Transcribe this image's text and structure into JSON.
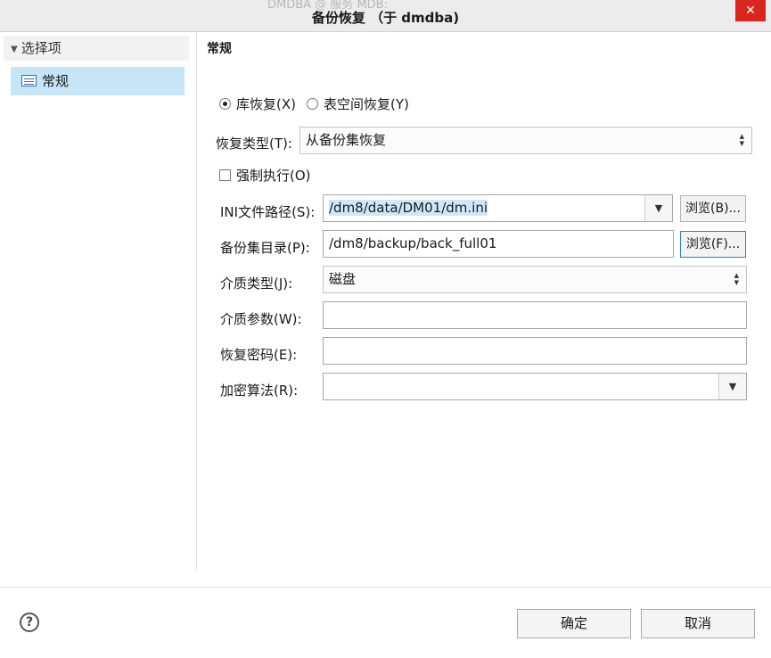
{
  "window": {
    "title": "备份恢复 （于 dmdba)",
    "ghost_title": "DMDBA @ 服务 MDB:",
    "close_label": "✕"
  },
  "sidebar": {
    "header": "选择项",
    "items": [
      {
        "label": "常规"
      }
    ]
  },
  "section_title": "常规",
  "restore_mode": {
    "options": [
      {
        "label": "库恢复(X)",
        "selected": true
      },
      {
        "label": "表空间恢复(Y)",
        "selected": false
      }
    ]
  },
  "form": {
    "restore_type": {
      "label": "恢复类型(T):",
      "value": "从备份集恢复"
    },
    "force": {
      "label": "强制执行(O)",
      "checked": false
    },
    "ini_path": {
      "label": "INI文件路径(S):",
      "value": "/dm8/data/DM01/dm.ini",
      "browse": "浏览(B)..."
    },
    "backup_dir": {
      "label": "备份集目录(P):",
      "value": "/dm8/backup/back_full01",
      "browse": "浏览(F)..."
    },
    "media_type": {
      "label": "介质类型(J):",
      "value": "磁盘"
    },
    "media_params": {
      "label": "介质参数(W):",
      "value": ""
    },
    "restore_password": {
      "label": "恢复密码(E):",
      "value": ""
    },
    "encrypt_algo": {
      "label": "加密算法(R):",
      "value": ""
    }
  },
  "footer": {
    "help_icon": "?",
    "ok": "确定",
    "cancel": "取消"
  },
  "colors": {
    "selection_bg": "#c6e5f6",
    "close_red": "#d9251c",
    "focus_blue": "#2d7fd1"
  }
}
